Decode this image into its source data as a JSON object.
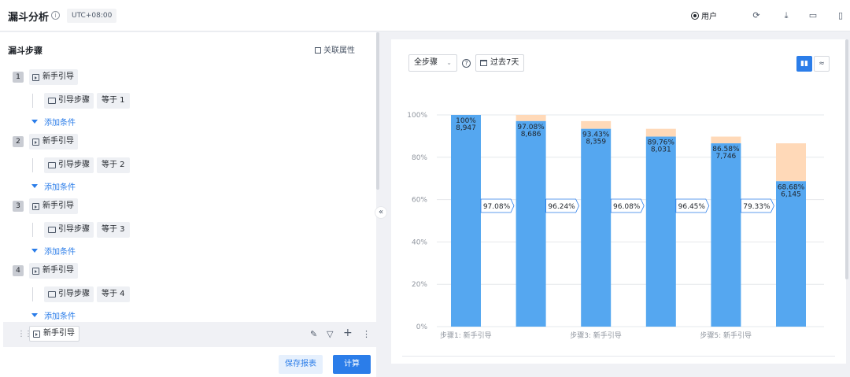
{
  "header": {
    "title": "漏斗分析",
    "timezone": "UTC+08:00",
    "user_label": "用户"
  },
  "left": {
    "title": "漏斗步骤",
    "related_attr": "关联属性",
    "steps": [
      {
        "num": "1",
        "event": "新手引导",
        "prop": "引导步骤",
        "op": "等于 1",
        "add": "添加条件"
      },
      {
        "num": "2",
        "event": "新手引导",
        "prop": "引导步骤",
        "op": "等于 2",
        "add": "添加条件"
      },
      {
        "num": "3",
        "event": "新手引导",
        "prop": "引导步骤",
        "op": "等于 3",
        "add": "添加条件"
      },
      {
        "num": "4",
        "event": "新手引导",
        "prop": "引导步骤",
        "op": "等于 4",
        "add": "添加条件"
      }
    ],
    "pending_event": "新手引导",
    "save": "保存报表",
    "calc": "计算"
  },
  "right": {
    "step_select": "全步骤",
    "date_range": "过去7天"
  },
  "colors": {
    "accent": "#2b7de9",
    "bar": "#55a7f0",
    "loss": "#ffd9b8"
  },
  "chart_data": {
    "type": "bar",
    "ylim": [
      0,
      100
    ],
    "yticks": [
      "0%",
      "20%",
      "40%",
      "60%",
      "80%",
      "100%"
    ],
    "x_labels": [
      "步骤1: 新手引导",
      "",
      "步骤3: 新手引导",
      "",
      "步骤5: 新手引导",
      ""
    ],
    "series": [
      {
        "name": "",
        "values": [
          100,
          97.08,
          93.43,
          89.76,
          86.58,
          68.68
        ]
      },
      {
        "name": "",
        "values": [
          0,
          2.92,
          3.65,
          3.67,
          3.18,
          17.9
        ]
      }
    ],
    "pct_labels": [
      "100%",
      "97.08%",
      "93.43%",
      "89.76%",
      "86.58%",
      "68.68%"
    ],
    "count_labels": [
      "8,947",
      "8,686",
      "8,359",
      "8,031",
      "7,746",
      "6,145"
    ],
    "conversion_labels": [
      "97.08%",
      "96.24%",
      "96.08%",
      "96.45%",
      "79.33%"
    ],
    "grid": true
  }
}
